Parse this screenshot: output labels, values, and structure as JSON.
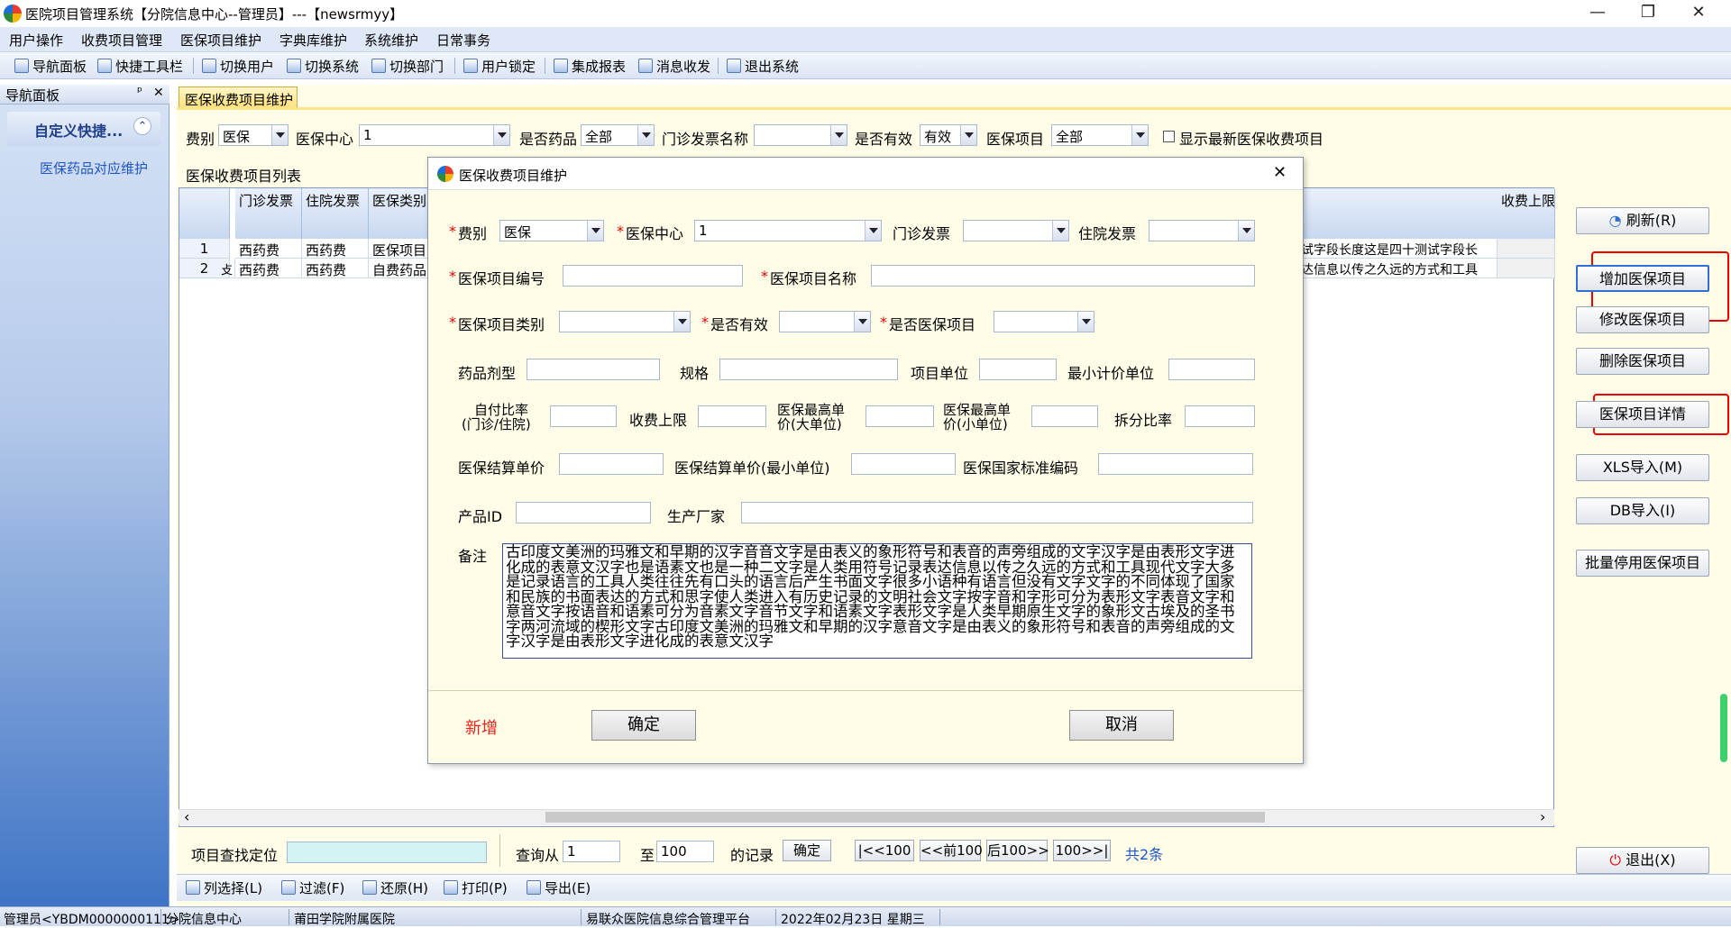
{
  "window": {
    "title": "医院项目管理系统【分院信息中心--管理员】---【newsrmyy】",
    "minimize": "—",
    "restore": "❐",
    "close": "✕"
  },
  "menu": [
    "用户操作",
    "收费项目管理",
    "医保项目维护",
    "字典库维护",
    "系统维护",
    "日常事务"
  ],
  "toolbar": [
    "导航面板",
    "快捷工具栏",
    "切换用户",
    "切换系统",
    "切换部门",
    "用户锁定",
    "集成报表",
    "消息收发",
    "退出系统"
  ],
  "nav": {
    "header": "导航面板",
    "pin": "ᵖ",
    "close": "✕",
    "section": "自定义快捷...",
    "section_toggle": "⌃",
    "item": "医保药品对应维护"
  },
  "tab": "医保收费项目维护",
  "filter": {
    "feibie_label": "费别",
    "feibie_value": "医保",
    "center_label": "医保中心",
    "center_value": "1",
    "isdrug_label": "是否药品",
    "isdrug_value": "全部",
    "outpatient_invoice_label": "门诊发票名称",
    "outpatient_invoice_value": "",
    "valid_label": "是否有效",
    "valid_value": "有效",
    "item_label": "医保项目",
    "item_value": "全部",
    "show_latest_label": "显示最新医保收费项目"
  },
  "list_title": "医保收费项目列表",
  "grid": {
    "headers": [
      "门诊发票",
      "住院发票",
      "医保类别",
      "收费上限"
    ],
    "rows": [
      {
        "no": "1",
        "outpatient": "西药费",
        "inpatient": "西药费",
        "category": "医保项目",
        "remark": "试字段长度这是四十测试字段长"
      },
      {
        "no": "2",
        "prefix": "攴",
        "outpatient": "西药费",
        "inpatient": "西药费",
        "category": "自费药品",
        "remark": "达信息以传之久远的方式和工具"
      }
    ],
    "scroll_left": "‹",
    "scroll_right": "›"
  },
  "actions": {
    "refresh": "刷新(R)",
    "add": "增加医保项目",
    "edit": "修改医保项目",
    "delete": "删除医保项目",
    "detail": "医保项目详情",
    "xls_import": "XLS导入(M)",
    "db_import": "DB导入(I)",
    "batch_disable": "批量停用医保项目",
    "exit": "退出(X)"
  },
  "search": {
    "locate_label": "项目查找定位",
    "query_from_label": "查询从",
    "from_value": "1",
    "to_label": "至",
    "to_value": "100",
    "records_label": "的记录",
    "confirm": "确定",
    "first": "|<<100",
    "prev": "<<前100",
    "next": "后100>>",
    "last": "100>>|",
    "total": "共2条"
  },
  "bottom_tools": [
    "列选择(L)",
    "过滤(F)",
    "还原(H)",
    "打印(P)",
    "导出(E)"
  ],
  "status": [
    "管理员<YBDM0000000111>",
    "分院信息中心",
    "莆田学院附属医院",
    "易联众医院信息综合管理平台",
    "2022年02月23日 星期三"
  ],
  "dialog": {
    "title": "医保收费项目维护",
    "close": "✕",
    "asterisk": "*",
    "feibie_label": "费别",
    "feibie_value": "医保",
    "center_label": "医保中心",
    "center_value": "1",
    "outpatient_invoice_label": "门诊发票",
    "inpatient_invoice_label": "住院发票",
    "code_label": "医保项目编号",
    "name_label": "医保项目名称",
    "category_label": "医保项目类别",
    "valid_label": "是否有效",
    "is_item_label": "是否医保项目",
    "dosage_label": "药品剂型",
    "spec_label": "规格",
    "unit_label": "项目单位",
    "min_unit_label": "最小计价单位",
    "selfpay_label_1": "自付比率",
    "selfpay_label_2": "(门诊/住院)",
    "fee_cap_label": "收费上限",
    "max_price_big_1": "医保最高单",
    "max_price_big_2": "价(大单位)",
    "max_price_small_1": "医保最高单",
    "max_price_small_2": "价(小单位)",
    "split_ratio_label": "拆分比率",
    "settle_price_label": "医保结算单价",
    "settle_price_min_label": "医保结算单价(最小单位)",
    "national_code_label": "医保国家标准编码",
    "product_id_label": "产品ID",
    "manufacturer_label": "生产厂家",
    "remark_label": "备注",
    "remark_text": "古印度文美洲的玛雅文和早期的汉字音音文字是由表义的象形符号和表音的声旁组成的文字汉字是由表形文字进化成的表意文汉字也是语素文也是一种二文字是人类用符号记录表达信息以传之久远的方式和工具现代文字大多是记录语言的工具人类往往先有口头的语言后产生书面文字很多小语种有语言但没有文字文字的不同体现了国家和民族的书面表达的方式和思字使人类进入有历史记录的文明社会文字按字音和字形可分为表形文字表音文字和意音文字按语音和语素可分为音素文字音节文字和语素文字表形文字是人类早期原生文字的象形文古埃及的圣书字两河流域的楔形文字古印度文美洲的玛雅文和早期的汉字意音文字是由表义的象形符号和表音的声旁组成的文字汉字是由表形文字进化成的表意文汉字",
    "mode": "新增",
    "ok": "确定",
    "cancel": "取消"
  },
  "colors": {
    "required": "#dd0000",
    "highlight_box": "#ee0000",
    "mode_text": "#e8241a",
    "link_blue": "#1f56c2"
  }
}
